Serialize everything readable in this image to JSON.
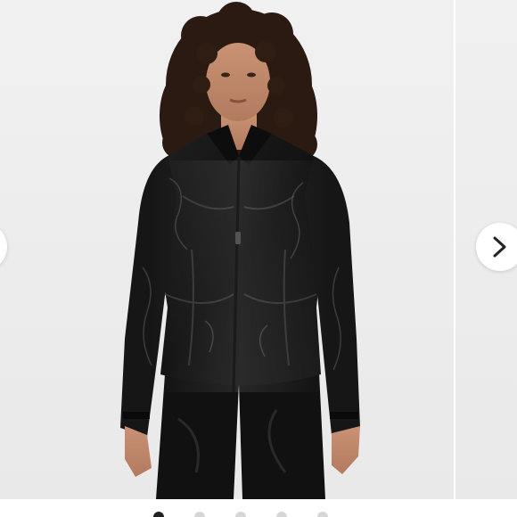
{
  "carousel": {
    "image": {
      "subject": "model-in-black-zip-jacket",
      "background_color": "#eeeeee",
      "jacket_color": "#141414"
    },
    "prev_button": {
      "icon": "chevron-left-icon"
    },
    "next_button": {
      "icon": "chevron-right-icon"
    },
    "pagination": {
      "total": 5,
      "active": 1,
      "active_color": "#222222",
      "inactive_color": "#d6d6d6"
    }
  }
}
